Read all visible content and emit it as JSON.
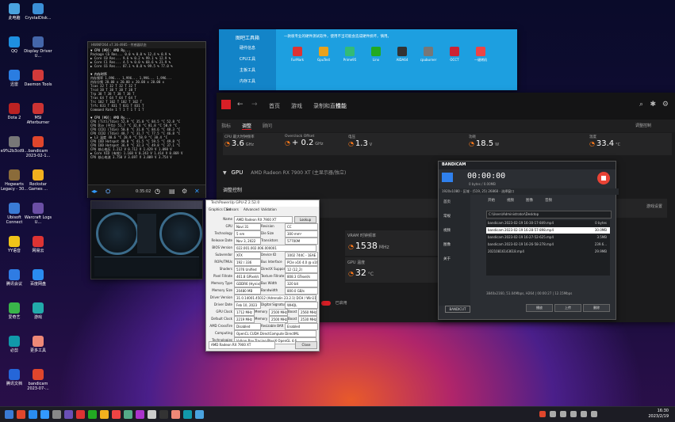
{
  "desktop_icons": [
    {
      "label": "此电脑",
      "color": "#4aa3df"
    },
    {
      "label": "CrystalDisk...",
      "color": "#3b8fd6"
    },
    {
      "label": "QQ",
      "color": "#1e8fe0"
    },
    {
      "label": "Display Driver U...",
      "color": "#4466aa"
    },
    {
      "label": "迅雷",
      "color": "#2a7de1"
    },
    {
      "label": "Daemon Tools",
      "color": "#d23a3a"
    },
    {
      "label": "Dota 2",
      "color": "#b22"
    },
    {
      "label": "MSI Afterburner",
      "color": "#c33"
    },
    {
      "label": "e9%2b3cd9...",
      "color": "#777"
    },
    {
      "label": "bandicam 2023-02-1...",
      "color": "#e0462c"
    },
    {
      "label": "Hogwarts Legacy - 30...",
      "color": "#8a6b3a"
    },
    {
      "label": "Rockstar Games ...",
      "color": "#f2b01e"
    },
    {
      "label": "Ubisoft Connect",
      "color": "#3a7bd5"
    },
    {
      "label": "Warcraft Logs U...",
      "color": "#6b4fa5"
    },
    {
      "label": "YY语音",
      "color": "#f0c419"
    },
    {
      "label": "网易云",
      "color": "#d33"
    },
    {
      "label": "腾讯会议",
      "color": "#2f7ce3"
    },
    {
      "label": "百度网盘",
      "color": "#2a8cf0"
    },
    {
      "label": "爱奇艺",
      "color": "#39b54a"
    },
    {
      "label": "游戏",
      "color": "#2aa"
    },
    {
      "label": "必剪",
      "color": "#19a"
    },
    {
      "label": "更多工具",
      "color": "#e87"
    },
    {
      "label": "腾讯文档",
      "color": "#2566d8"
    },
    {
      "label": "bandicam 2023-07-...",
      "color": "#e0462c"
    }
  ],
  "hwinfo": {
    "title": "HWiNFO64 v7.36-4985 - 传感器状态",
    "rows": [
      {
        "t": "▼ CPU [#0]: AMD Ry...",
        "h": true
      },
      {
        "t": "  Package C6 Res...  0.0 %   0.0 %   12.4 %   0.9 %"
      },
      {
        "t": "  ▶ Core C0 Res...   9.6 %   0.2 %   99.1 %   12.9 %"
      },
      {
        "t": "  ▶ Core C1 Res...   4.5 %   0.0 %   68.6 %   21.9 %"
      },
      {
        "t": "  ▶ Core C6 Res...  87.1 %   0.0 %   99.5 %   77.0 %"
      },
      {
        "t": ""
      },
      {
        "t": "▼ 内存时序",
        "h": true
      },
      {
        "t": "  内存频率          1,996...  1,996...  1,996...  1,996..."
      },
      {
        "t": "  内存分频          20.00 x   20.00 x   20.00 x   20.00 x"
      },
      {
        "t": "  Tcas              32 T      32 T      32 T      32 T"
      },
      {
        "t": "  Trcd              38 T      38 T      38 T      38 T"
      },
      {
        "t": "  Trp               38 T      38 T      38 T      38 T"
      },
      {
        "t": "  Tras              64 T      64 T      64 T      64 T"
      },
      {
        "t": "  Trc               102 T     102 T     102 T     102 T"
      },
      {
        "t": "  Trfc              831 T     831 T     831 T     831 T"
      },
      {
        "t": "  Command Rate      1 T       1 T       1 T       1 T"
      },
      {
        "t": ""
      },
      {
        "t": "▼ CPU [#0]: AMD Ry...",
        "h": true
      },
      {
        "t": "  CPU (Tctl/Tdie)   52.9 °C   35.0 °C   84.5 °C   52.8 °C"
      },
      {
        "t": "  CPU Die (平均)    51.7 °C   32.8 °C   81.8 °C   50.9 °C"
      },
      {
        "t": "  CPU CCD1 (Tdie)   50.0 °C   31.8 °C   84.6 °C   48.3 °C"
      },
      {
        "t": "  CPU CCD2 (Tdie)   48.7 °C   31.7 °C   77.5 °C   46.8 °C"
      },
      {
        "t": "  ▶ L3 温度          40.6 °C   28.9 °C   58.9 °C   38.4 °C"
      },
      {
        "t": "  CPU IOD Hotspot   48.0 °C   41.5 °C   59.5 °C   49.8 °C"
      },
      {
        "t": "  CPU IOD Hotspot   36.9 °C   32.3 °C   49.8 °C   37.1 °C"
      },
      {
        "t": "  CPU 核心电压      1.212 V   0.712 V   1.429 V   1.098 V"
      },
      {
        "t": "  ▶ Core VID (有效)  1.168 V   0.243 V   1.414 V   0.869 V"
      },
      {
        "t": "  CPU 核心电流      3.750 V   3.697 V   3.809 V   3.754 V"
      }
    ],
    "clock": "0:35:02"
  },
  "launcher": {
    "nav": [
      "图吧工具箱",
      "硬件信息",
      "CPU工具",
      "主板工具",
      "内存工具"
    ],
    "banner": "一款很专业的硬件测试软件，使用不当可能会造成硬件损坏，慎用。",
    "tools": [
      "FurMark",
      "GpuTest",
      "Prime95",
      "Linx",
      "AIDA64",
      "cpuburner",
      "OCCT",
      "一键烤机"
    ],
    "tool_colors": [
      "#d33",
      "#e9a21c",
      "#3b7",
      "#2a2",
      "#333",
      "#777",
      "#c23",
      "#e44"
    ]
  },
  "amd": {
    "tabs": [
      "首页",
      "游戏",
      "录制和直播",
      "性能"
    ],
    "subtabs": [
      "指标",
      "调整",
      "顾问"
    ],
    "active_subtab": "调整",
    "right_label": "调整控制",
    "cpu_stats": [
      {
        "label": "CPU 最大时钟频率",
        "value": "3.6",
        "unit": "GHz"
      },
      {
        "label": "Overclock Offset",
        "value": "+ 0.2",
        "unit": "GHz"
      },
      {
        "label": "电压",
        "value": "1.3",
        "unit": "V"
      },
      {
        "label": "功耗",
        "value": "18.5",
        "unit": "W"
      },
      {
        "label": "温度",
        "value": "33.4",
        "unit": "°C"
      }
    ],
    "gpu_title": "GPU",
    "gpu_name": "AMD Radeon RX 7900 XT (主显示器/独立)",
    "gpu_control_label": "调整控制",
    "vram_label": "VRAM 时钟频率",
    "vram_value": "1538",
    "vram_unit": "MHz",
    "gpu_temp_label": "GPU 温度",
    "gpu_temp_value": "32",
    "gpu_temp_unit": "°C",
    "bottom_label": "已启用",
    "gpu_right_label": "游戏设置"
  },
  "gpuz": {
    "title": "TechPowerUp GPU-Z 2.52.0",
    "tabs": [
      "Graphics Card",
      "Sensors",
      "Advanced",
      "Validation"
    ],
    "rows": [
      {
        "l": "Name",
        "v": "AMD Radeon RX 7900 XT",
        "btn": "Lookup"
      },
      {
        "l": "GPU",
        "v": "Navi 31",
        "l2": "Revision",
        "v2": "CC"
      },
      {
        "l": "Technology",
        "v": "5 nm",
        "l2": "Die Size",
        "v2": "300 mm²"
      },
      {
        "l": "Release Date",
        "v": "Nov 3, 2022",
        "l2": "Transistors",
        "v2": "57700M"
      },
      {
        "l": "BIOS Version",
        "v": "022.001.002.006.000001"
      },
      {
        "l": "Subvendor",
        "v": "XFX",
        "l2": "Device ID",
        "v2": "1002 744C - 1EAE 7903"
      },
      {
        "l": "ROPs/TMUs",
        "v": "192 / 336",
        "l2": "Bus Interface",
        "v2": "PCIe x16 4.0 @ x16 4.0"
      },
      {
        "l": "Shaders",
        "v": "5376 Unified",
        "l2": "DirectX Support",
        "v2": "12 (12_2)"
      },
      {
        "l": "Pixel Fillrate",
        "v": "461.8 GPixel/s",
        "l2": "Texture Fillrate",
        "v2": "808.3 GTexel/s"
      },
      {
        "l": "Memory Type",
        "v": "GDDR6 (Hynix)",
        "l2": "Bus Width",
        "v2": "320 bit"
      },
      {
        "l": "Memory Size",
        "v": "20480 MB",
        "l2": "Bandwidth",
        "v2": "800.0 GB/s"
      },
      {
        "l": "Driver Version",
        "v": "31.0.14001.45012 (Adrenalin 23.2.1) DCH / Win11 64"
      },
      {
        "l": "Driver Date",
        "v": "Feb 10, 2023",
        "l2": "Digital Signature",
        "v2": "WHQL"
      },
      {
        "l": "GPU Clock",
        "v": "1712 MHz",
        "l2": "Memory",
        "v2": "2500 MHz",
        "l3": "Boost",
        "v3": "2560 MHz"
      },
      {
        "l": "Default Clock",
        "v": "2219 MHz",
        "l2": "Memory",
        "v2": "2500 MHz",
        "l3": "Boost",
        "v3": "2530 MHz"
      },
      {
        "l": "AMD CrossFire",
        "v": "Disabled",
        "l2": "Resizable BAR",
        "v2": "Enabled"
      },
      {
        "l": "Computing",
        "v": "OpenCL  CUDA  DirectCompute  DirectML"
      },
      {
        "l": "Technologies",
        "v": "Vulkan  Ray Tracing  PhysX  OpenGL 4.6"
      }
    ],
    "selected": "AMD Radeon RX 7900 XT",
    "close": "Close"
  },
  "bandicam": {
    "brand": "BANDICAM",
    "timer": "00:00:00",
    "size": "0 bytes / 0.00MB",
    "info_bar": "1920x1080 - 区域 - (519, 25) 26868 - 选择窗口",
    "menu": [
      "首页",
      "常规",
      "视频",
      "图像",
      "关于"
    ],
    "tabs": [
      "开始",
      "视频",
      "图像",
      "音频"
    ],
    "path": "C:\\Users\\Administrator\\Desktop",
    "files": [
      {
        "n": "bandicam 2023-02-19 16-30-17-849.mp4",
        "s": "0 bytes"
      },
      {
        "n": "bandicam 2023-02-19 16-28-57-898.mp4",
        "s": "30.0MB"
      },
      {
        "n": "bandicam 2023-02-19 16-27-52-625.mp4",
        "s": "3.5MB"
      },
      {
        "n": "bandicam 2023-02-19 16-26-58-278.mp4",
        "s": "239.6..."
      },
      {
        "n": "20210816143618.mp4",
        "s": "29.9MB"
      }
    ],
    "status": "3840x2160, 51.04Mbps, H264 | 00:00:27 | 12.15Mbps",
    "buttons": [
      "播放",
      "上传",
      "删除"
    ],
    "corner": "BANDICUT"
  },
  "taskbar": {
    "time": "16:30",
    "date": "2023/2/19"
  }
}
